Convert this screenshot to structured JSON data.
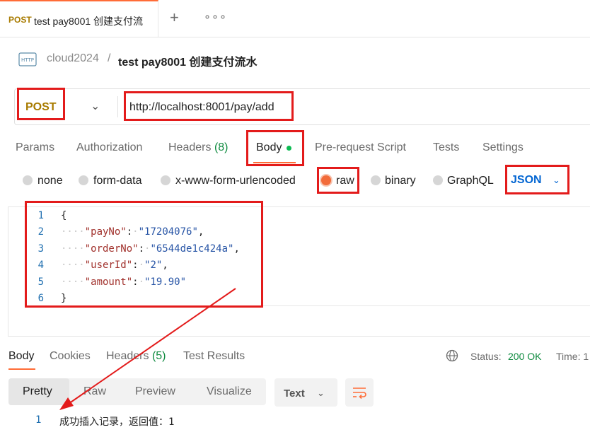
{
  "tab": {
    "method": "POST",
    "name": "test pay8001 创建支付流"
  },
  "breadcrumb": {
    "collection": "cloud2024",
    "separator": "/",
    "title": "test pay8001 创建支付流水"
  },
  "request": {
    "method": "POST",
    "url": "http://localhost:8001/pay/add"
  },
  "request_tabs": {
    "params": "Params",
    "authorization": "Authorization",
    "headers": "Headers",
    "headers_count": "(8)",
    "body": "Body",
    "prerequest": "Pre-request Script",
    "tests": "Tests",
    "settings": "Settings"
  },
  "body_types": {
    "none": "none",
    "form_data": "form-data",
    "urlencoded": "x-www-form-urlencoded",
    "raw": "raw",
    "binary": "binary",
    "graphql": "GraphQL",
    "selected": "raw",
    "language": "JSON"
  },
  "editor": {
    "line_numbers": [
      "1",
      "2",
      "3",
      "4",
      "5",
      "6"
    ],
    "open_brace": "{",
    "close_brace": "}",
    "fields": [
      {
        "key": "\"payNo\"",
        "value": "\"17204076\"",
        "comma": ","
      },
      {
        "key": "\"orderNo\"",
        "value": "\"6544de1c424a\"",
        "comma": ","
      },
      {
        "key": "\"userId\"",
        "value": "\"2\"",
        "comma": ","
      },
      {
        "key": "\"amount\"",
        "value": "\"19.90\"",
        "comma": ""
      }
    ]
  },
  "response_tabs": {
    "body": "Body",
    "cookies": "Cookies",
    "headers": "Headers",
    "headers_count": "(5)",
    "test_results": "Test Results"
  },
  "response_status": {
    "label": "Status:",
    "value": "200 OK",
    "time_label": "Time: 1"
  },
  "format_toolbar": {
    "pretty": "Pretty",
    "raw": "Raw",
    "preview": "Preview",
    "visualize": "Visualize",
    "type": "Text"
  },
  "response_body": {
    "line": "1",
    "text": "成功插入记录，返回值：1"
  },
  "icons": {
    "http": "http-icon",
    "plus": "plus-icon",
    "more": "more-icon",
    "globe": "globe-icon",
    "wrap": "wrap-lines-icon",
    "chevron": "chevron-down-icon"
  },
  "colors": {
    "annotation": "#e31b1b",
    "method": "#a87b00",
    "accent": "#ff6c37",
    "status_ok": "#0d8a3e",
    "link_blue": "#0265d2"
  }
}
